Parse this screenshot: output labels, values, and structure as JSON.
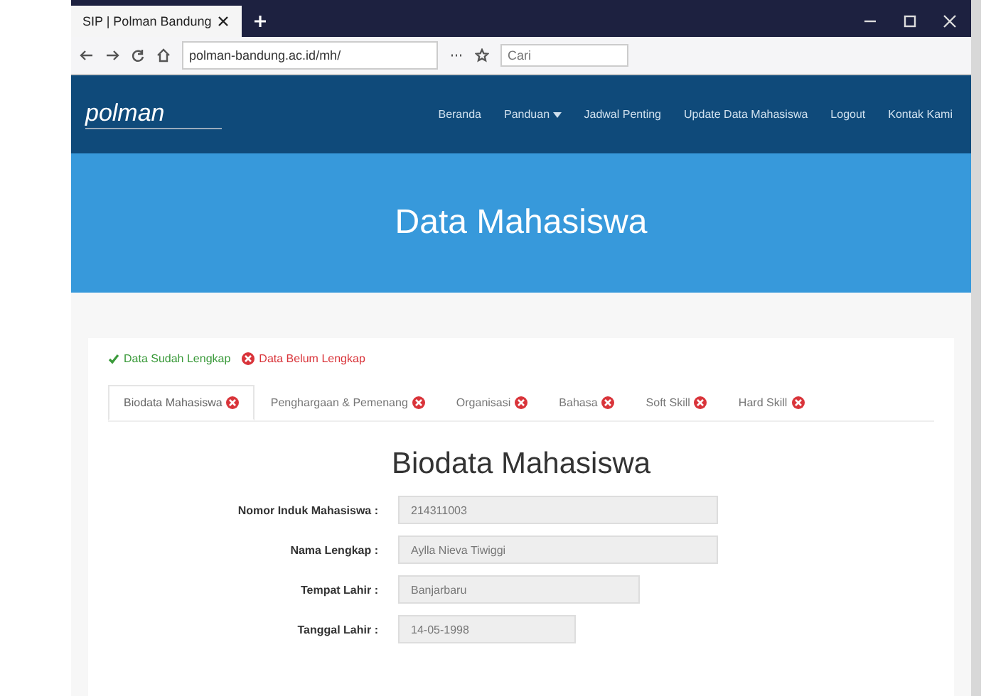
{
  "browser": {
    "tab_title": "SIP | Polman Bandung",
    "url": "polman-bandung.ac.id/mh/",
    "search": {
      "placeholder": "Cari"
    }
  },
  "navbar": {
    "logo": "polman",
    "items": [
      {
        "label": "Beranda",
        "dropdown": false
      },
      {
        "label": "Panduan",
        "dropdown": true
      },
      {
        "label": "Jadwal Penting",
        "dropdown": false
      },
      {
        "label": "Update Data Mahasiswa",
        "dropdown": false
      },
      {
        "label": "Logout",
        "dropdown": false
      },
      {
        "label": "Kontak Kami",
        "dropdown": false
      }
    ]
  },
  "hero": {
    "title": "Data Mahasiswa"
  },
  "legend": [
    {
      "label": "Data Sudah Lengkap",
      "complete": true
    },
    {
      "label": "Data Belum Lengkap",
      "complete": false
    }
  ],
  "tabs": [
    {
      "label": "Biodata Mahasiswa",
      "selected": true,
      "complete": false
    },
    {
      "label": "Penghargaan & Pemenang",
      "selected": false,
      "complete": false
    },
    {
      "label": "Organisasi",
      "selected": false,
      "complete": false
    },
    {
      "label": "Bahasa",
      "selected": false,
      "complete": false
    },
    {
      "label": "Soft Skill",
      "selected": false,
      "complete": false
    },
    {
      "label": "Hard Skill",
      "selected": false,
      "complete": false
    }
  ],
  "form": {
    "title": "Biodata Mahasiswa",
    "fields": [
      {
        "label": "Nomor Induk Mahasiswa :",
        "value": "214311003"
      },
      {
        "label": "Nama Lengkap :",
        "value": "Aylla Nieva Tiwiggi"
      },
      {
        "label": "Tempat Lahir :",
        "value": "Banjarbaru"
      },
      {
        "label": "Tanggal Lahir :",
        "value": "14-05-1998"
      }
    ]
  }
}
